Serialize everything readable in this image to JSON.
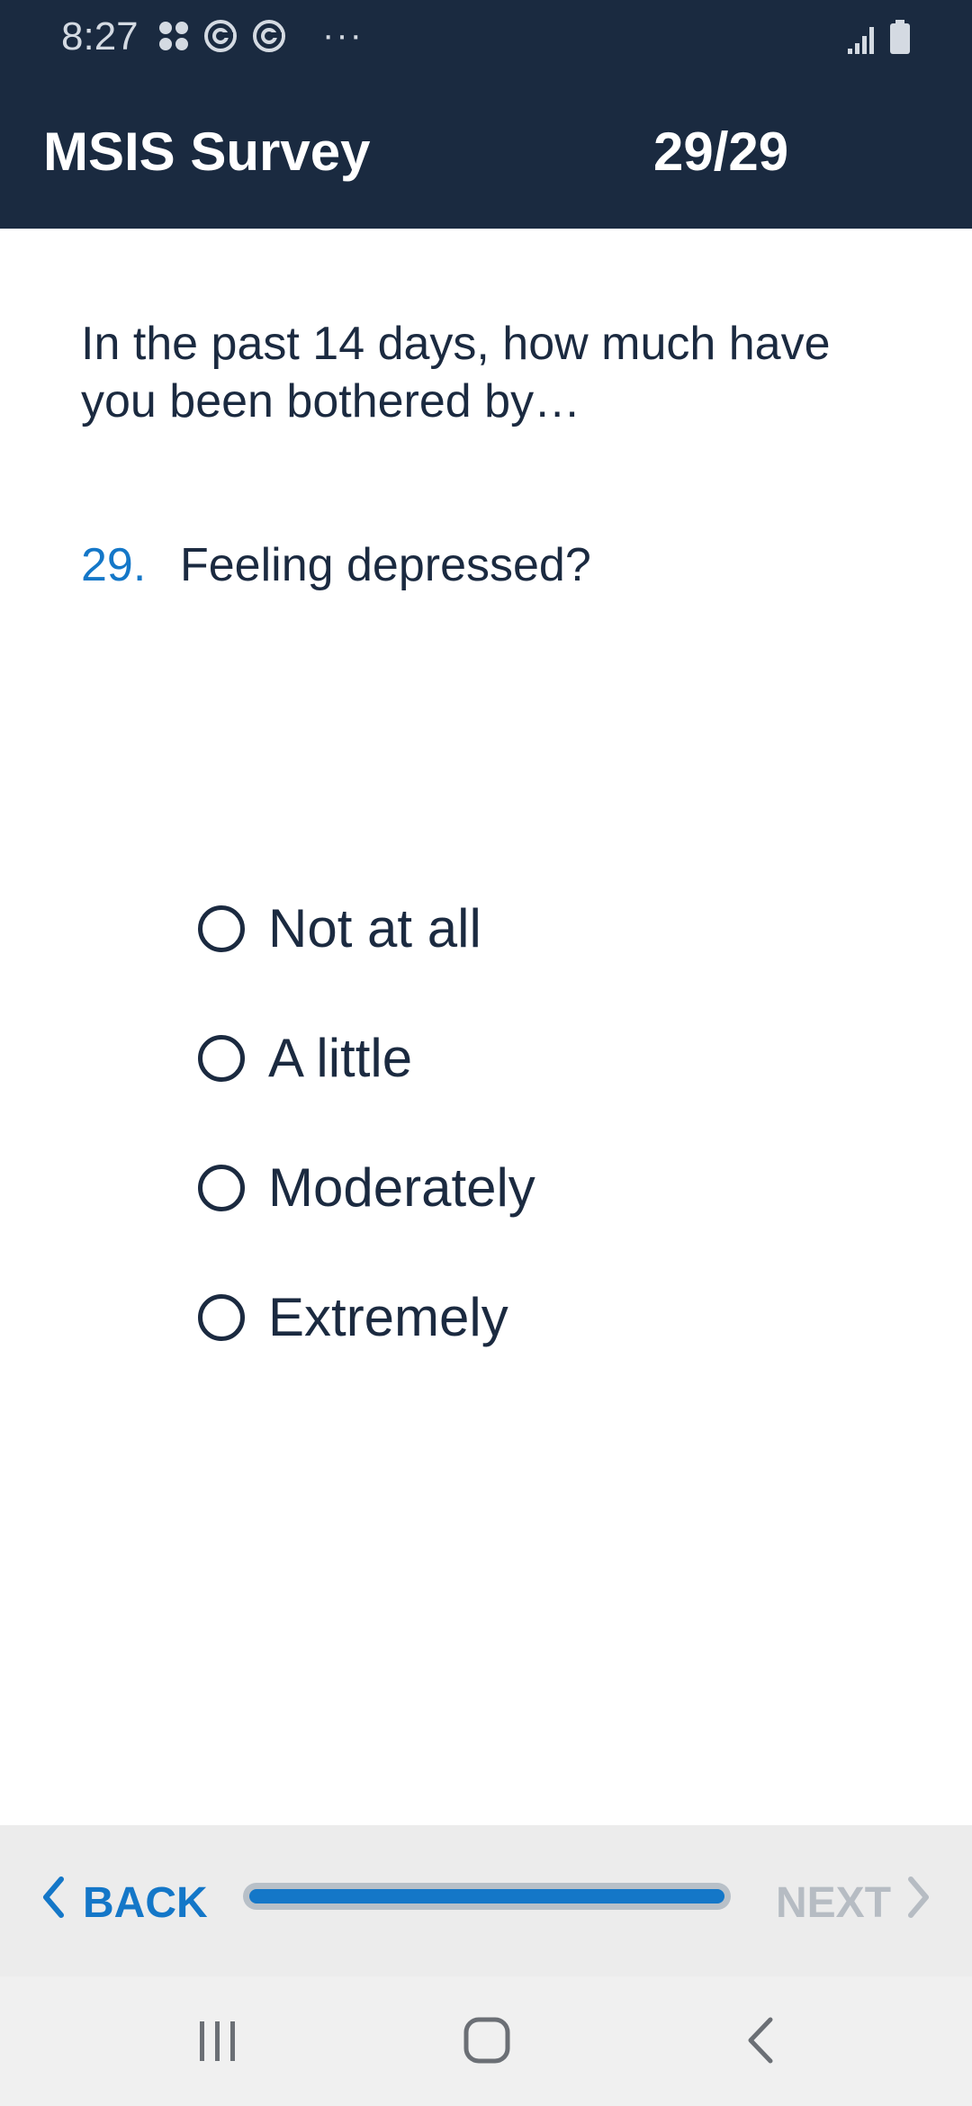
{
  "status_bar": {
    "time": "8:27",
    "more": "···"
  },
  "app_bar": {
    "title": "MSIS Survey",
    "counter": "29/29"
  },
  "prompt": "In the past 14 days, how much have you been bothered by…",
  "question": {
    "number": "29.",
    "text": "Feeling depressed?"
  },
  "options": [
    {
      "label": "Not at all",
      "selected": false
    },
    {
      "label": "A little",
      "selected": false
    },
    {
      "label": "Moderately",
      "selected": false
    },
    {
      "label": "Extremely",
      "selected": false
    }
  ],
  "footer": {
    "back_label": "BACK",
    "next_label": "NEXT",
    "progress": 1.0
  },
  "colors": {
    "header_bg": "#1a2a40",
    "accent": "#1477c8",
    "text": "#1b2a40",
    "disabled": "#b6bcc3"
  },
  "icons": {
    "status_left": [
      "grid-apps-icon",
      "sync-icon",
      "sync-icon"
    ],
    "status_right": [
      "signal-icon",
      "battery-icon"
    ],
    "back": "chevron-left-icon",
    "next": "chevron-right-icon",
    "nav": [
      "recent-apps-icon",
      "home-icon",
      "nav-back-icon"
    ]
  }
}
